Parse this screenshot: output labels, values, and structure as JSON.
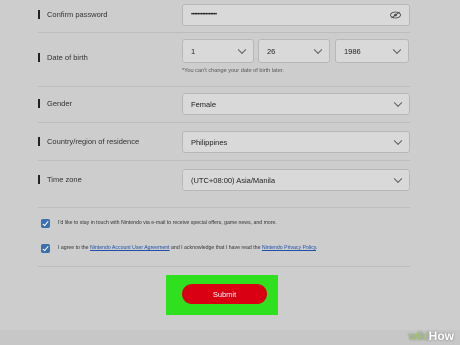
{
  "form": {
    "confirm_password": {
      "label": "Confirm password",
      "value": "••••••••••••••••"
    },
    "date_of_birth": {
      "label": "Date of birth",
      "month": "1",
      "day": "26",
      "year": "1986",
      "hint": "*You can't change your date of birth later."
    },
    "gender": {
      "label": "Gender",
      "value": "Female"
    },
    "country": {
      "label": "Country/region of residence",
      "value": "Philippines"
    },
    "time_zone": {
      "label": "Time zone",
      "value": "(UTC+08:00) Asia/Manila"
    },
    "newsletter_text": "I'd like to stay in touch with Nintendo via e-mail to receive special offers, game news, and more.",
    "agree": {
      "prefix": "I agree to the ",
      "agreement_link": "Nintendo Account User Agreement",
      "middle": " and I acknowledge that I have read the ",
      "privacy_link": "Nintendo Privacy Policy",
      "suffix": "."
    },
    "submit_label": "Submit"
  },
  "watermark": {
    "wiki": "wiki",
    "how": "How"
  },
  "colors": {
    "submit": "#d90014",
    "highlight": "#2fe01e",
    "checkbox": "#3a6fb0"
  }
}
